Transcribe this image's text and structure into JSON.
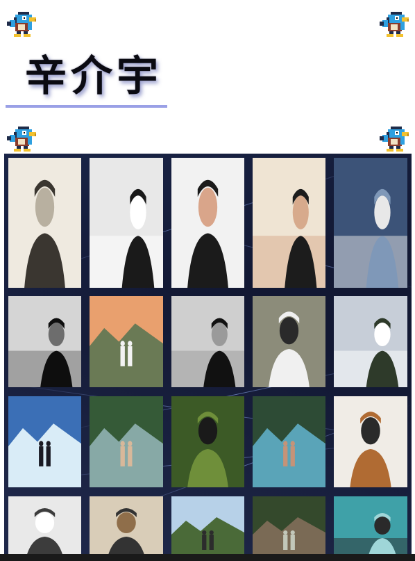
{
  "page": {
    "title": "辛介宇",
    "accent_color": "#9aa0e6",
    "gallery_background": "#121833"
  },
  "decorations": {
    "icon": "bird-sprite-icon"
  },
  "gallery": {
    "rows": 4,
    "columns": 5,
    "photos": [
      {
        "icon": "sketch-portrait-photo",
        "palette": [
          "#efeae0",
          "#3a3630",
          "#b8b0a0"
        ]
      },
      {
        "icon": "man-black-jacket-photo",
        "palette": [
          "#e8e8e8",
          "#1a1a1a",
          "#ffffff"
        ]
      },
      {
        "icon": "selfie-peace-sign-photo",
        "palette": [
          "#f2f2f2",
          "#1b1b1b",
          "#d9a58a"
        ]
      },
      {
        "icon": "earphones-profile-photo",
        "palette": [
          "#efe4d3",
          "#1c1c1c",
          "#d7aa8c"
        ]
      },
      {
        "icon": "building-wall-photo",
        "palette": [
          "#3c5378",
          "#7f98b8",
          "#e8e8e8"
        ]
      },
      {
        "icon": "dark-room-portrait-photo",
        "palette": [
          "#d5d5d5",
          "#0e0e0e",
          "#6d6d6d"
        ]
      },
      {
        "icon": "sunset-couple-photo",
        "palette": [
          "#e9a06e",
          "#6a7a55",
          "#f3f3f3"
        ]
      },
      {
        "icon": "sky-silhouette-photo",
        "palette": [
          "#cfcfcf",
          "#111111",
          "#9a9a9a"
        ]
      },
      {
        "icon": "dog-street-photo",
        "palette": [
          "#8c8c7a",
          "#f0f0f0",
          "#2a2a2a"
        ]
      },
      {
        "icon": "city-overlook-photo",
        "palette": [
          "#c7ced8",
          "#2e3a2a",
          "#ffffff"
        ]
      },
      {
        "icon": "sea-rocks-photo",
        "palette": [
          "#3b6fb6",
          "#d9ecf7",
          "#1a1a24"
        ]
      },
      {
        "icon": "waterfall-forest-photo",
        "palette": [
          "#355a37",
          "#87a9a6",
          "#d8b89a"
        ]
      },
      {
        "icon": "leaves-face-photo",
        "palette": [
          "#3c5a26",
          "#6f8f3a",
          "#1a1a1a"
        ]
      },
      {
        "icon": "friends-waterfall-photo",
        "palette": [
          "#2d4b35",
          "#5aa4b8",
          "#c59378"
        ]
      },
      {
        "icon": "orange-hoodie-photo",
        "palette": [
          "#f0ece6",
          "#b06b33",
          "#2a2a2a"
        ]
      },
      {
        "icon": "umbrella-portrait-photo",
        "palette": [
          "#e9e9e9",
          "#3c3c3c",
          "#ffffff"
        ]
      },
      {
        "icon": "station-selfie-photo",
        "palette": [
          "#d9cdb8",
          "#333333",
          "#8f6e4a"
        ]
      },
      {
        "icon": "mountain-hike-photo",
        "palette": [
          "#b7d1e8",
          "#4a6a38",
          "#2c2c2c"
        ]
      },
      {
        "icon": "forest-pavilion-photo",
        "palette": [
          "#34492c",
          "#7a6a55",
          "#c2c7b9"
        ]
      },
      {
        "icon": "underwater-photo",
        "palette": [
          "#3fa1a8",
          "#9fd6d8",
          "#2a2a2a"
        ]
      }
    ]
  }
}
